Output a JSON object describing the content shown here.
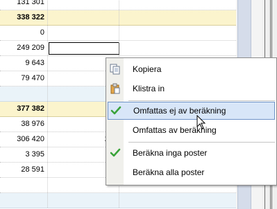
{
  "grid": {
    "rows": [
      {
        "value": "131 301",
        "col2": "",
        "style": "normal",
        "dropdown": true
      },
      {
        "value": "338 322",
        "col2": "",
        "style": "bold",
        "dropdown": false
      },
      {
        "value": "0",
        "col2": "",
        "style": "normal",
        "dropdown": true
      },
      {
        "value": "249 209",
        "col2": "",
        "style": "normal",
        "dropdown": true,
        "editing": true
      },
      {
        "value": "9 643",
        "col2": "",
        "style": "normal",
        "dropdown": false
      },
      {
        "value": "79 470",
        "col2": "",
        "style": "normal",
        "dropdown": false
      },
      {
        "value": "",
        "col2": "",
        "style": "sep",
        "dropdown": false
      },
      {
        "value": "377 382",
        "col2": "",
        "style": "bold",
        "dropdown": false
      },
      {
        "value": "38 976",
        "col2": "",
        "style": "normal",
        "dropdown": false
      },
      {
        "value": "306 420",
        "col2": "20,",
        "style": "normal",
        "dropdown": false
      },
      {
        "value": "3 395",
        "col2": "",
        "style": "normal",
        "dropdown": false
      },
      {
        "value": "28 591",
        "col2": "",
        "style": "normal",
        "dropdown": false
      },
      {
        "value": "",
        "col2": "",
        "style": "normal",
        "dropdown": false
      },
      {
        "value": "",
        "col2": "",
        "style": "sep",
        "dropdown": false
      }
    ]
  },
  "context_menu": {
    "items": [
      {
        "label": "Kopiera",
        "icon": "copy-icon"
      },
      {
        "label": "Klistra in",
        "icon": "paste-icon"
      },
      {
        "label": "Omfattas ej av beräkning",
        "icon": "checkmark-icon",
        "highlighted": true
      },
      {
        "label": "Omfattas av beräkning",
        "icon": ""
      },
      {
        "label": "Beräkna inga poster",
        "icon": "checkmark-icon"
      },
      {
        "label": "Beräkna alla poster",
        "icon": ""
      }
    ]
  },
  "colors": {
    "bold_row_bg": "#fbf4cd",
    "separator_row_bg": "#eaf3f9",
    "menu_highlight_bg": "#d8e6f8",
    "menu_highlight_border": "#6e93c7",
    "check_green": "#3aa33a"
  }
}
